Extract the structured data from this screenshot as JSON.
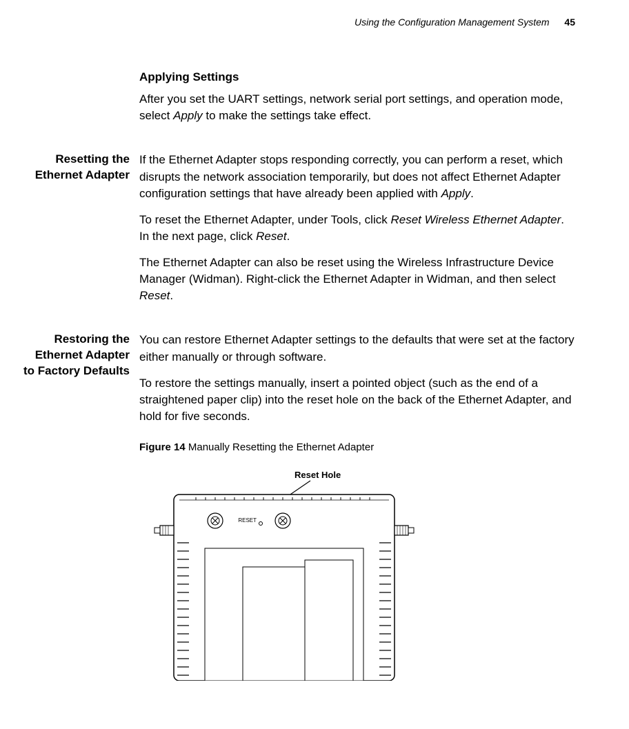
{
  "header": {
    "running_title": "Using the Configuration Management System",
    "page_number": "45"
  },
  "sections": {
    "applying": {
      "title": "Applying Settings",
      "p1_a": "After you set the UART settings, network serial port settings, and operation mode, select ",
      "p1_em": "Apply",
      "p1_b": " to make the settings take effect."
    },
    "resetting": {
      "side_title": "Resetting the Ethernet Adapter",
      "p1_a": "If the Ethernet Adapter stops responding correctly, you can perform a reset, which disrupts the network association temporarily, but does not affect Ethernet Adapter configuration settings that have already been applied with ",
      "p1_em": "Apply",
      "p1_b": ".",
      "p2_a": "To reset the Ethernet Adapter, under Tools, click ",
      "p2_em1": "Reset Wireless Ethernet Adapter",
      "p2_mid": ". In the next page, click ",
      "p2_em2": "Reset",
      "p2_b": ".",
      "p3_a": "The Ethernet Adapter can also be reset using the Wireless Infrastructure Device Manager (Widman). Right-click the Ethernet Adapter in Widman, and then select ",
      "p3_em": "Reset",
      "p3_b": "."
    },
    "restoring": {
      "side_title": "Restoring the Ethernet Adapter to Factory Defaults",
      "p1": "You can restore Ethernet Adapter settings to the defaults that were set at the factory either manually or through software.",
      "p2": "To restore the settings manually, insert a pointed object (such as the end of a straightened paper clip) into the reset hole on the back of the Ethernet Adapter, and hold for five seconds."
    },
    "figure": {
      "number": "Figure 14",
      "caption": "   Manually Resetting the Ethernet Adapter",
      "callout": "Reset Hole",
      "reset_label": "RESET"
    }
  }
}
